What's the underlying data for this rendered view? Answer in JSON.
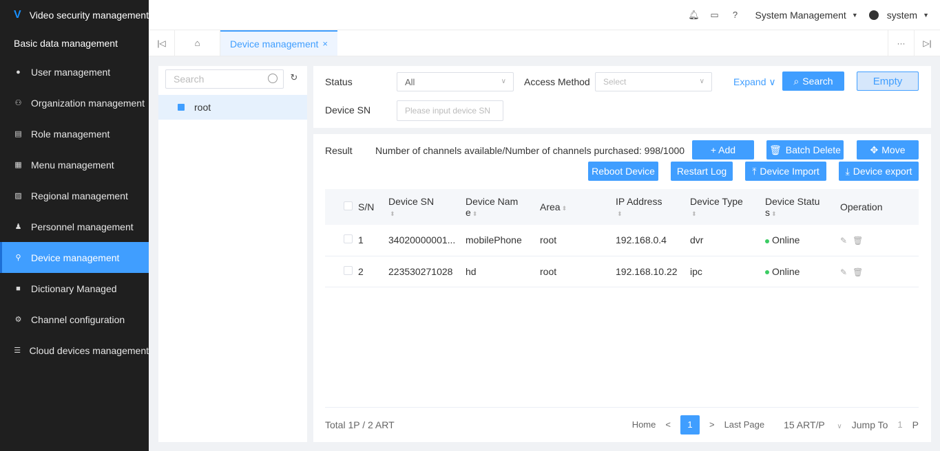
{
  "sidebar": {
    "brand": "Video security management",
    "section_title": "Basic data management",
    "items": [
      {
        "label": "User management",
        "icon": "user-icon",
        "glyph": "●"
      },
      {
        "label": "Organization management",
        "icon": "org-icon",
        "glyph": "⚇"
      },
      {
        "label": "Role management",
        "icon": "role-icon",
        "glyph": "▤"
      },
      {
        "label": "Menu management",
        "icon": "menu-icon",
        "glyph": "▦"
      },
      {
        "label": "Regional management",
        "icon": "region-icon",
        "glyph": "▨"
      },
      {
        "label": "Personnel management",
        "icon": "personnel-icon",
        "glyph": "♟"
      },
      {
        "label": "Device management",
        "icon": "device-icon",
        "glyph": "⚲",
        "active": true
      },
      {
        "label": "Dictionary Managed",
        "icon": "dictionary-icon",
        "glyph": "■"
      },
      {
        "label": "Channel configuration",
        "icon": "channel-icon",
        "glyph": "⚙"
      },
      {
        "label": "Cloud devices management",
        "icon": "cloud-devices-icon",
        "glyph": "☰"
      }
    ]
  },
  "header": {
    "system_menu": "System Management",
    "user": "system"
  },
  "tabs": {
    "active_label": "Device management",
    "close": "×"
  },
  "tree": {
    "search_placeholder": "Search",
    "root_label": "root"
  },
  "filters": {
    "status_label": "Status",
    "status_value": "All",
    "access_label": "Access Method",
    "access_placeholder": "Select",
    "device_sn_label": "Device SN",
    "device_sn_placeholder": "Please input device SN",
    "expand_label": "Expand",
    "search_label": "Search",
    "empty_label": "Empty"
  },
  "result": {
    "label": "Result",
    "channels_text": "Number of channels available/Number of channels purchased: 998/1000",
    "buttons": {
      "add": "+ Add",
      "batch_delete": "Batch Delete",
      "move": "Move",
      "reboot": "Reboot Device",
      "restart_log": "Restart Log",
      "device_import": "Device Import",
      "device_export": "Device export"
    }
  },
  "table": {
    "headers": {
      "sn": "S/N",
      "device_sn": "Device SN",
      "device_name_line1": "Device Nam",
      "device_name_line2": "e",
      "area": "Area",
      "ip": "IP Address",
      "type": "Device Type",
      "status_line1": "Device Statu",
      "status_line2": "s",
      "operation": "Operation"
    },
    "rows": [
      {
        "sn": "1",
        "device_sn": "34020000001...",
        "name": "mobilePhone",
        "area": "root",
        "ip": "192.168.0.4",
        "type": "dvr",
        "status": "Online"
      },
      {
        "sn": "2",
        "device_sn": "223530271028",
        "name": "hd",
        "area": "root",
        "ip": "192.168.10.22",
        "type": "ipc",
        "status": "Online"
      }
    ]
  },
  "pagination": {
    "total": "Total 1P / 2 ART",
    "home": "Home",
    "prev": "<",
    "current": "1",
    "next": ">",
    "last": "Last Page",
    "per_page": "15 ART/P",
    "jump_label": "Jump To",
    "jump_value": "1",
    "jump_unit": "P"
  },
  "colors": {
    "accent": "#409eff",
    "sidebar_bg": "#1f1f1f",
    "online": "#3bcc63"
  }
}
